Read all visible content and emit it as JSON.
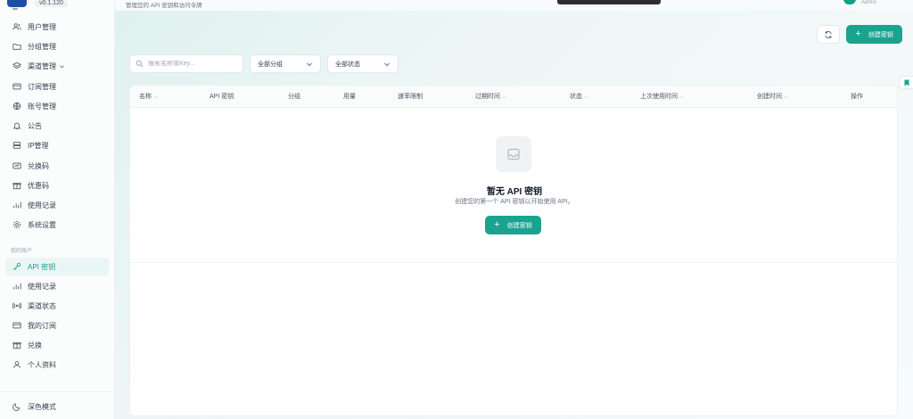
{
  "app": {
    "version": "v0.1.120"
  },
  "header": {
    "subtitle": "管理您的 API 密钥和访问令牌",
    "user_role": "Admin"
  },
  "sidebar": {
    "admin_items": [
      {
        "label": "用户管理",
        "icon": "users-icon"
      },
      {
        "label": "分组管理",
        "icon": "folder-icon"
      },
      {
        "label": "渠道管理",
        "icon": "layers-icon"
      },
      {
        "label": "订阅管理",
        "icon": "card-icon"
      },
      {
        "label": "账号管理",
        "icon": "globe-icon"
      },
      {
        "label": "公告",
        "icon": "bell-icon"
      },
      {
        "label": "IP管理",
        "icon": "server-icon"
      },
      {
        "label": "兑换码",
        "icon": "ticket-icon"
      },
      {
        "label": "优惠码",
        "icon": "gift-icon"
      },
      {
        "label": "使用记录",
        "icon": "bar-chart-icon"
      },
      {
        "label": "系统设置",
        "icon": "gear-icon"
      }
    ],
    "section_label": "我的账户",
    "user_items": [
      {
        "label": "API 密钥",
        "icon": "key-icon",
        "active": true
      },
      {
        "label": "使用记录",
        "icon": "bar-chart-icon"
      },
      {
        "label": "渠道状态",
        "icon": "signal-icon"
      },
      {
        "label": "我的订阅",
        "icon": "card-icon"
      },
      {
        "label": "兑换",
        "icon": "gift-icon"
      },
      {
        "label": "个人资料",
        "icon": "user-icon"
      }
    ],
    "dark_mode_label": "深色模式"
  },
  "toolbar": {
    "create_label": "创建密钥",
    "search_placeholder": "搜索名称或Key...",
    "group_filter": "全部分组",
    "status_filter": "全部状态"
  },
  "table": {
    "columns": [
      "名称",
      "API 密钥",
      "分组",
      "用量",
      "速率限制",
      "过期时间",
      "状态",
      "上次使用时间",
      "创建时间",
      "操作"
    ],
    "empty_title": "暂无 API 密钥",
    "empty_desc": "创建您的第一个 API 密钥以开始使用 API。",
    "empty_action": "创建密钥"
  },
  "colors": {
    "accent": "#1aa38f",
    "active_bg": "#eaf6f3",
    "active_text": "#0f9b8e"
  }
}
